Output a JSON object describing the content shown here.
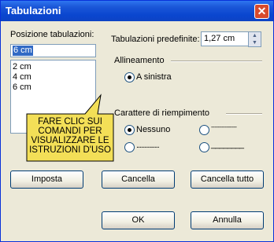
{
  "window": {
    "title": "Tabulazioni"
  },
  "tab_positions": {
    "label": "Posizione tabulazioni:",
    "current_value": "6 cm",
    "items": [
      "2 cm",
      "4 cm",
      "6 cm"
    ]
  },
  "default_tabs": {
    "label": "Tabulazioni predefinite:",
    "value": "1,27 cm"
  },
  "alignment": {
    "group_label": "Allineamento",
    "option_left": "A sinistra"
  },
  "fill_char": {
    "group_label": "Carattere di riempimento",
    "option_none": "Nessuno",
    "option_dashes": "---------------",
    "option_dots": "..............",
    "option_line": "________"
  },
  "callout": {
    "line1": "FARE CLIC SUI",
    "line2": "COMANDI PER",
    "line3": "VISUALIZZARE LE",
    "line4": "ISTRUZIONI D'USO"
  },
  "buttons": {
    "set": "Imposta",
    "clear": "Cancella",
    "clear_all": "Cancella tutto",
    "ok": "OK",
    "cancel": "Annulla"
  }
}
